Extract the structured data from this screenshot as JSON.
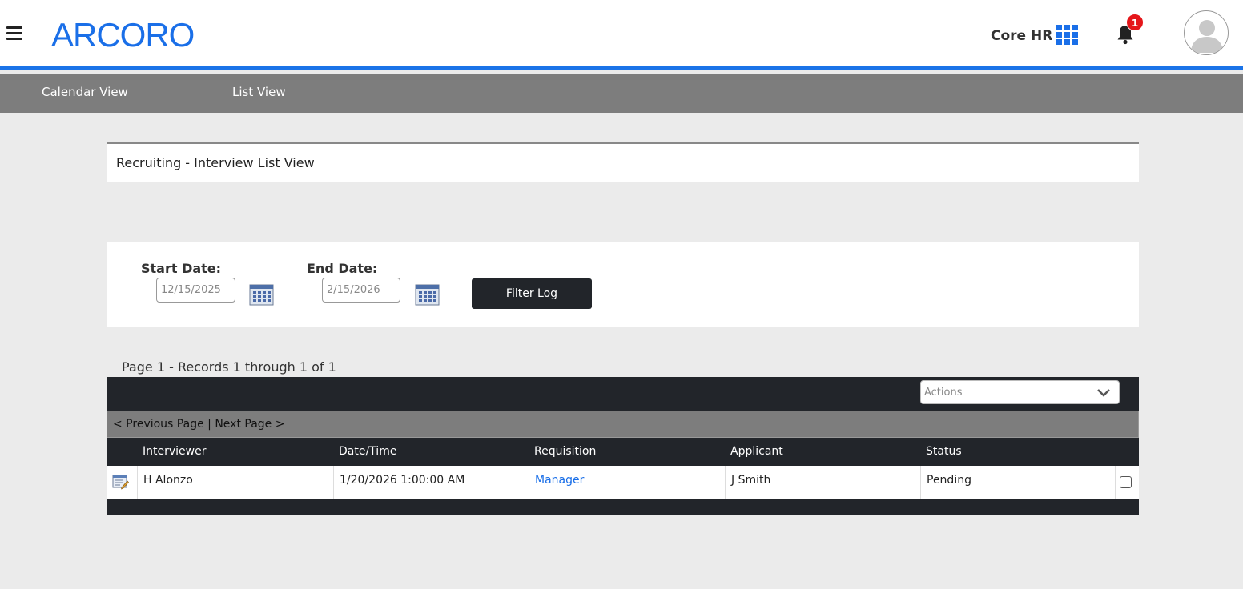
{
  "header": {
    "logo_text": "ARCORO",
    "product_label": "Core HR",
    "notification_count": "1",
    "brand_color": "#1a73e8"
  },
  "subnav": {
    "items": [
      {
        "label": "Calendar View"
      },
      {
        "label": "List View"
      }
    ]
  },
  "page": {
    "title": "Recruiting - Interview List View"
  },
  "filter": {
    "start_label": "Start Date:",
    "start_value": "12/15/2025",
    "end_label": "End Date:",
    "end_value": "2/15/2026",
    "button_label": "Filter Log"
  },
  "records": {
    "info": "Page 1 - Records 1 through 1 of 1",
    "actions_placeholder": "Actions",
    "prev_label": "< Previous Page",
    "separator": "|",
    "next_label": "Next Page >"
  },
  "table": {
    "columns": [
      "Interviewer",
      "Date/Time",
      "Requisition",
      "Applicant",
      "Status"
    ],
    "rows": [
      {
        "interviewer": "H Alonzo",
        "datetime": "1/20/2026 1:00:00 AM",
        "requisition": "Manager",
        "applicant": "J Smith",
        "status": "Pending"
      }
    ]
  }
}
